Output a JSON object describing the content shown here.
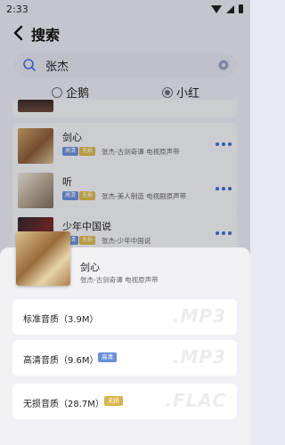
{
  "status_bar": {
    "time": "2:33"
  },
  "header": {
    "title": "搜索"
  },
  "search": {
    "value": "张杰"
  },
  "sources": [
    {
      "label": "企鹅",
      "selected": false
    },
    {
      "label": "小红",
      "selected": true
    }
  ],
  "results": [
    {
      "title": "剑心",
      "badges": [
        "高清",
        "无损"
      ],
      "meta": "张杰-古剑奇谭 电视原声带"
    },
    {
      "title": "听",
      "badges": [
        "高清",
        "无损"
      ],
      "meta": "张杰-美人制造 电视剧原声带"
    },
    {
      "title": "少年中国说",
      "badges": [
        "高清",
        "无损"
      ],
      "meta": "张杰-少年中国说"
    }
  ],
  "sheet": {
    "title": "剑心",
    "artist": "张杰-古剑奇谭 电视原声带",
    "options": [
      {
        "label": "标准音质（3.9M）",
        "badge": "",
        "ext": ".MP3"
      },
      {
        "label": "高清音质（9.6M）",
        "badge": "高清",
        "ext": ".MP3"
      },
      {
        "label": "无损音质（28.7M）",
        "badge": "无损",
        "ext": ".FLAC"
      }
    ]
  },
  "colors": {
    "accent": "#3e6ad8",
    "hq_badge": "#6a8fd8",
    "sq_badge": "#d8b44b"
  }
}
